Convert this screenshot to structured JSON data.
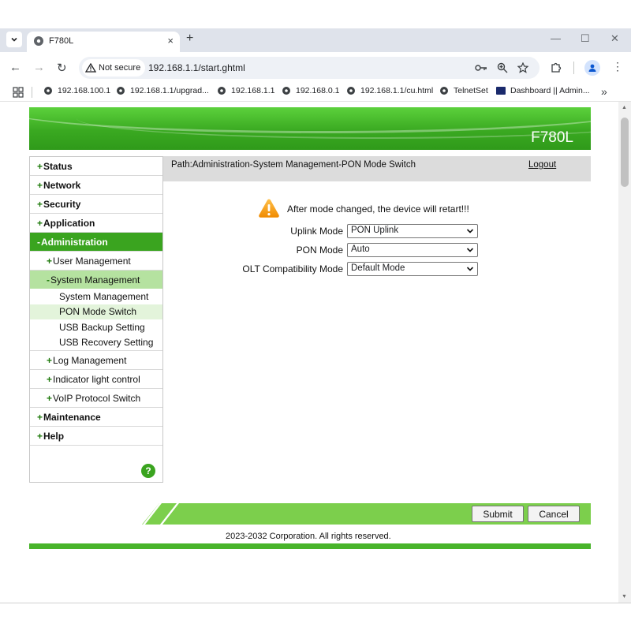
{
  "browser": {
    "tab_title": "F780L",
    "tab_close": "×",
    "new_tab": "+",
    "security_label": "Not secure",
    "url": "192.168.1.1/start.ghtml",
    "bookmarks": [
      {
        "label": "192.168.100.1"
      },
      {
        "label": "192.168.1.1/upgrad..."
      },
      {
        "label": "192.168.1.1"
      },
      {
        "label": "192.168.0.1"
      },
      {
        "label": "192.168.1.1/cu.html"
      },
      {
        "label": "TelnetSet"
      },
      {
        "label": "Dashboard || Admin..."
      }
    ]
  },
  "banner": {
    "model": "F780L"
  },
  "path_bar": {
    "path": "Path:Administration-System Management-PON Mode Switch",
    "logout": "Logout"
  },
  "sidebar": {
    "items": [
      {
        "prefix": "+",
        "label": "Status"
      },
      {
        "prefix": "+",
        "label": "Network"
      },
      {
        "prefix": "+",
        "label": "Security"
      },
      {
        "prefix": "+",
        "label": "Application"
      },
      {
        "prefix": "-",
        "label": "Administration"
      },
      {
        "prefix": "+",
        "label": "User Management"
      },
      {
        "prefix": "-",
        "label": "System Management"
      },
      {
        "label": "System Management"
      },
      {
        "label": "PON Mode Switch"
      },
      {
        "label": "USB Backup Setting"
      },
      {
        "label": "USB Recovery Setting"
      },
      {
        "prefix": "+",
        "label": "Log Management"
      },
      {
        "prefix": "+",
        "label": "Indicator light control"
      },
      {
        "prefix": "+",
        "label": "VoIP Protocol Switch"
      },
      {
        "prefix": "+",
        "label": "Maintenance"
      },
      {
        "prefix": "+",
        "label": "Help"
      }
    ],
    "help_icon": "?"
  },
  "content": {
    "warning": "After mode changed, the device will retart!!!",
    "fields": [
      {
        "label": "Uplink Mode",
        "value": "PON Uplink"
      },
      {
        "label": "PON Mode",
        "value": "Auto"
      },
      {
        "label": "OLT Compatibility Mode",
        "value": "Default Mode"
      }
    ]
  },
  "footer": {
    "submit": "Submit",
    "cancel": "Cancel",
    "copyright": "2023-2032 Corporation. All rights reserved."
  },
  "colors": {
    "brand_green": "#3aa41f",
    "active_submenu": "#b5e2a0",
    "active_leaf": "#e3f4db",
    "path_bar_bg": "#dcdcdc"
  },
  "icons": [
    "globe-icon",
    "warning-icon",
    "chevron-down-icon",
    "help-icon",
    "key-icon",
    "zoom-icon",
    "star-icon",
    "extensions-icon",
    "profile-icon",
    "more-icon",
    "apps-icon"
  ]
}
